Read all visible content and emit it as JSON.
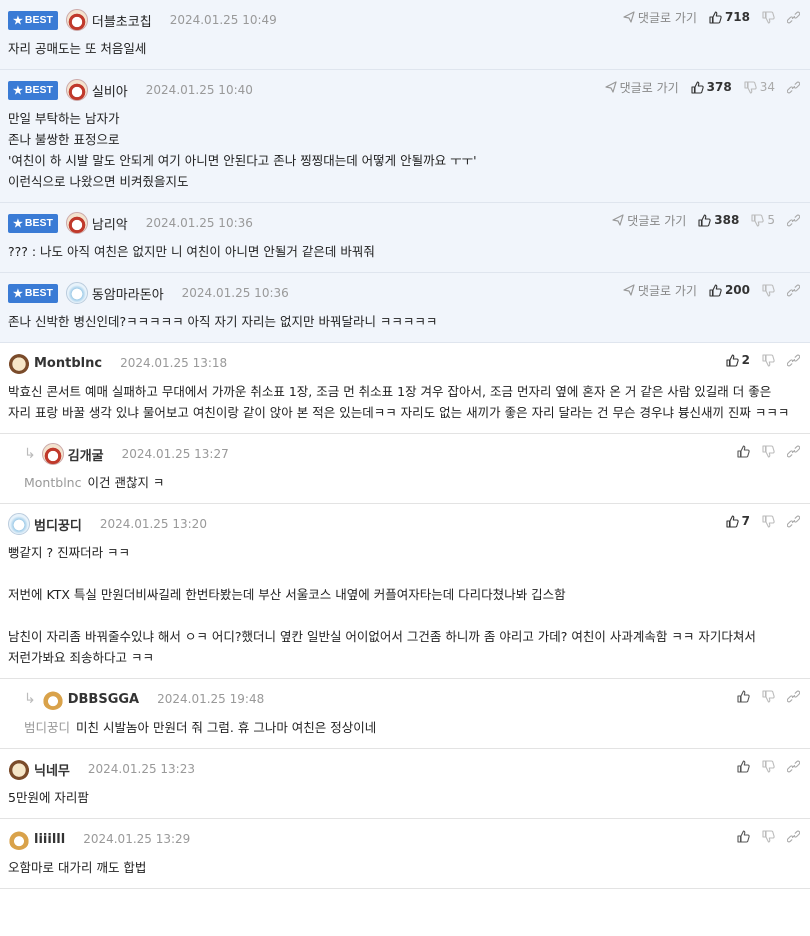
{
  "labels": {
    "best": "BEST",
    "reply": "댓글로 가기"
  },
  "comments": [
    {
      "kind": "best",
      "avatar": "dog",
      "nick": "더블초코칩",
      "date": "2024.01.25 10:49",
      "up": "718",
      "down": "",
      "body": "자리 공매도는 또 처음일세"
    },
    {
      "kind": "best",
      "avatar": "dog",
      "nick": "실비아",
      "date": "2024.01.25 10:40",
      "up": "378",
      "down": "34",
      "body": "만일 부탁하는 남자가\n존나 불쌍한 표정으로\n'여친이 하 시발 말도 안되게 여기 아니면 안된다고 존나 찡찡대는데 어떻게 안될까요 ㅜㅜ'\n이런식으로 나왔으면 비켜줬을지도"
    },
    {
      "kind": "best",
      "avatar": "dog",
      "nick": "남리악",
      "date": "2024.01.25 10:36",
      "up": "388",
      "down": "5",
      "body": "??? : 나도 아직 여친은 없지만 니 여친이 아니면 안될거 같은데 바꿔줘"
    },
    {
      "kind": "best",
      "avatar": "cat",
      "nick": "동암마라돈아",
      "date": "2024.01.25 10:36",
      "up": "200",
      "down": "",
      "body": "존나 신박한 병신인데?ㅋㅋㅋㅋㅋ 아직 자기 자리는 없지만 바꿔달라니 ㅋㅋㅋㅋㅋ"
    },
    {
      "kind": "normal",
      "avatar": "pup",
      "nick": "Montblnc",
      "date": "2024.01.25 13:18",
      "up": "2",
      "down": "",
      "body": "박효신 콘서트 예매 실패하고 무대에서 가까운 취소표 1장, 조금 먼 취소표 1장 겨우 잡아서, 조금 먼자리 옆에 혼자 온 거 같은 사람 있길래 더 좋은 자리 표랑 바꿀 생각 있냐 물어보고 여친이랑 같이 앉아 본 적은 있는데ㅋㅋ 자리도 없는 새끼가 좋은 자리 달라는 건 무슨 경우냐 븅신새끼 진짜 ㅋㅋㅋ"
    },
    {
      "kind": "reply",
      "avatar": "dog",
      "nick": "김개굴",
      "date": "2024.01.25 13:27",
      "up": "",
      "down": "",
      "mention": "Montblnc",
      "body": "이건 괜찮지 ㅋ"
    },
    {
      "kind": "normal",
      "avatar": "cat",
      "nick": "범디꿍디",
      "date": "2024.01.25 13:20",
      "up": "7",
      "down": "",
      "body": "뻥같지 ? 진짜더라 ㅋㅋ\n\n저번에 KTX 특실 만원더비싸길레 한번타봤는데 부산 서울코스 내옆에 커플여자타는데 다리다쳤나봐 깁스함\n\n남친이 자리좀 바꿔줄수있냐 해서 ㅇㅋ 어디?했더니 옆칸 일반실 어이없어서 그건좀 하니까 좀 야리고 가데? 여친이 사과계속함 ㅋㅋ 자기다쳐서 저런가봐요 죄송하다고 ㅋㅋ"
    },
    {
      "kind": "reply",
      "avatar": "fox",
      "nick": "DBBSGGA",
      "date": "2024.01.25 19:48",
      "up": "",
      "down": "",
      "mention": "범디꿍디",
      "body": "미친 시발놈아 만원더 줘 그럼. 휴 그나마 여친은 정상이네"
    },
    {
      "kind": "normal",
      "avatar": "pup",
      "nick": "닉네무",
      "date": "2024.01.25 13:23",
      "up": "",
      "down": "",
      "body": "5만원에 자리팜"
    },
    {
      "kind": "normal",
      "avatar": "fox",
      "nick": "liiilll",
      "date": "2024.01.25 13:29",
      "up": "",
      "down": "",
      "body": "오함마로 대가리 깨도 합법"
    }
  ]
}
